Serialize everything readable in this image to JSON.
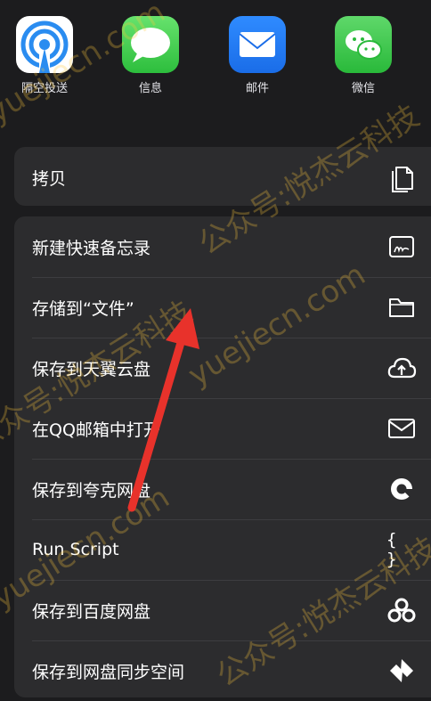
{
  "share_apps": [
    {
      "label": "隔空投送",
      "icon": "airdrop-icon"
    },
    {
      "label": "信息",
      "icon": "messages-icon"
    },
    {
      "label": "邮件",
      "icon": "mail-icon"
    },
    {
      "label": "微信",
      "icon": "wechat-icon"
    }
  ],
  "copy_group": {
    "label": "拷贝",
    "icon": "copy-icon"
  },
  "actions": [
    {
      "label": "新建快速备忘录",
      "icon": "quick-note-icon"
    },
    {
      "label": "存储到“文件”",
      "icon": "folder-icon"
    },
    {
      "label": "保存到天翼云盘",
      "icon": "cloud-upload-icon"
    },
    {
      "label": "在QQ邮箱中打开",
      "icon": "envelope-icon"
    },
    {
      "label": "保存到夸克网盘",
      "icon": "quark-icon"
    },
    {
      "label": "Run Script",
      "icon": "braces-icon",
      "icon_text": "{ }"
    },
    {
      "label": "保存到百度网盘",
      "icon": "baidu-netdisk-icon"
    },
    {
      "label": "保存到网盘同步空间",
      "icon": "sync-space-icon"
    }
  ],
  "watermarks": [
    {
      "text": "yuejiecn.com"
    },
    {
      "text": "公众号:悦杰云科技"
    }
  ],
  "colors": {
    "background": "#1c1c1e",
    "group": "#2c2c2e",
    "separator": "#3d3d40",
    "arrow": "#e8322b",
    "watermark": "#ffc83c"
  }
}
